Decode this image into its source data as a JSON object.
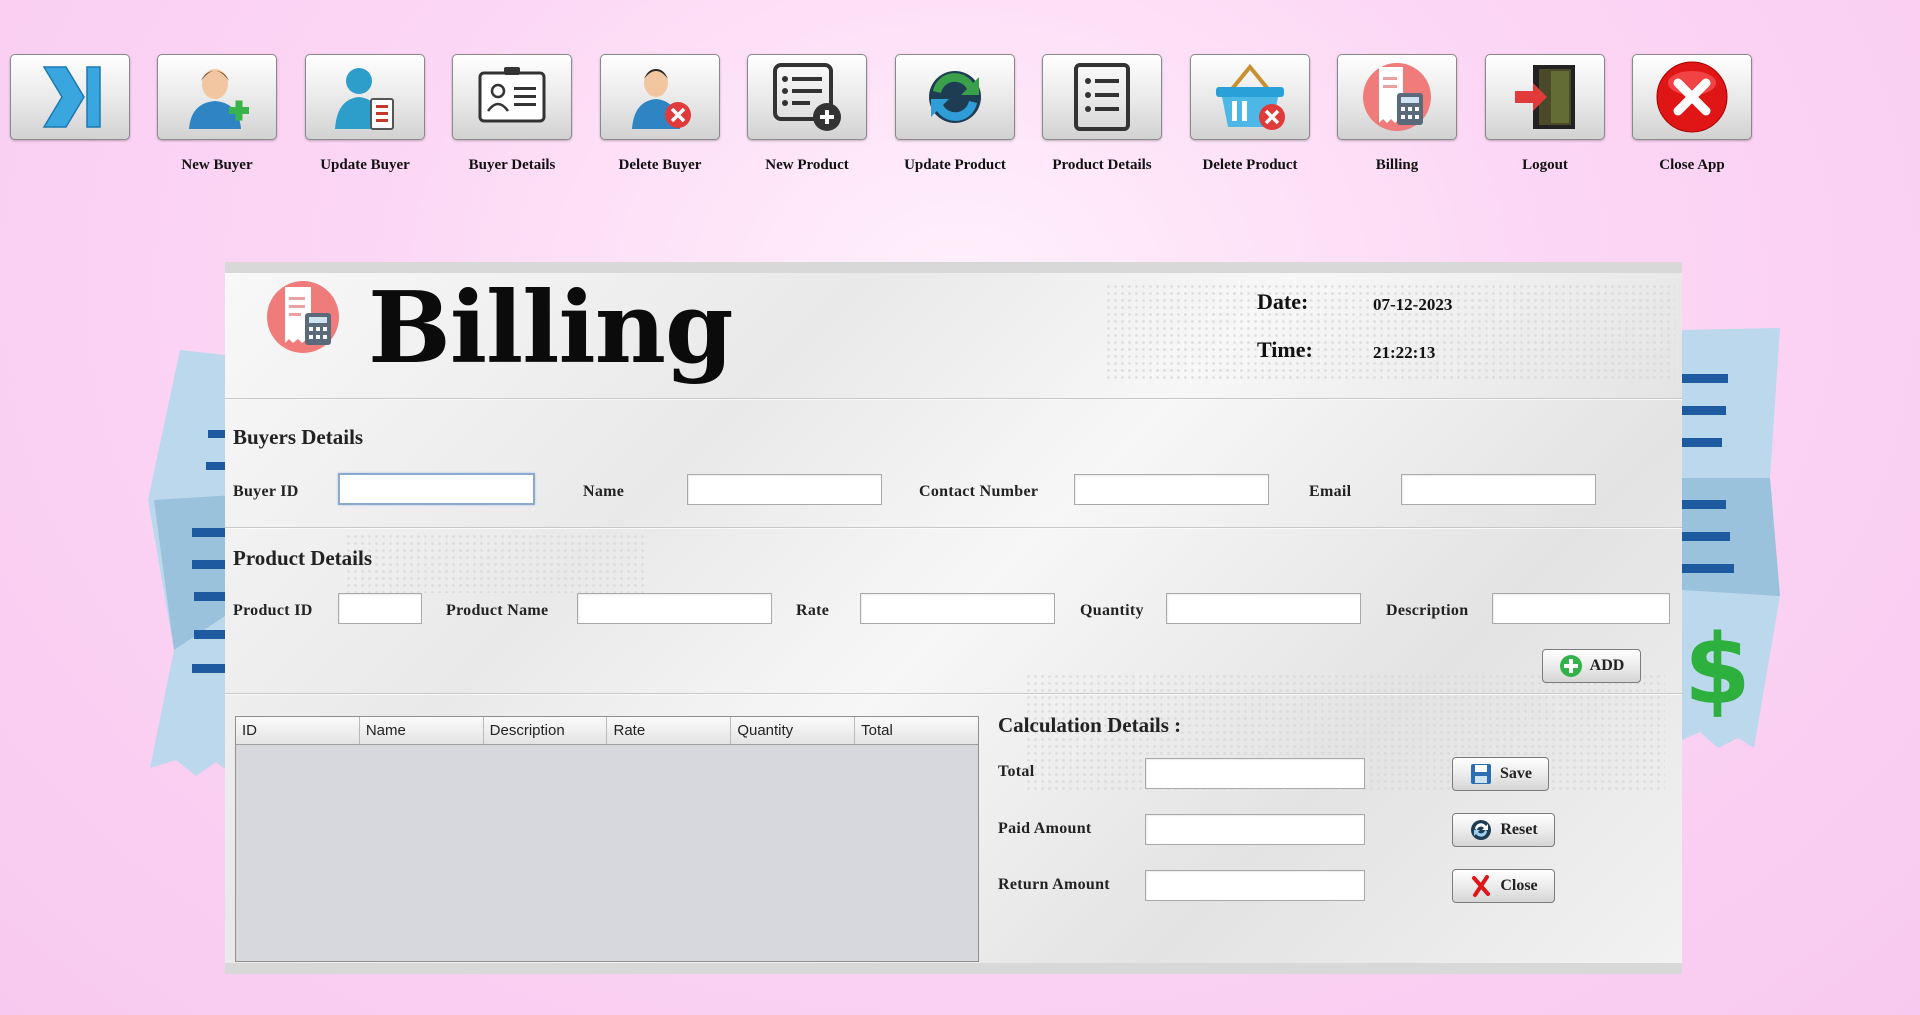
{
  "toolbar": {
    "items": [
      {
        "label": "",
        "icon": "skip-forward-icon"
      },
      {
        "label": "New Buyer",
        "icon": "add-user-icon"
      },
      {
        "label": "Update Buyer",
        "icon": "update-user-icon"
      },
      {
        "label": "Buyer Details",
        "icon": "id-card-icon"
      },
      {
        "label": "Delete Buyer",
        "icon": "delete-user-icon"
      },
      {
        "label": "New Product",
        "icon": "add-list-icon"
      },
      {
        "label": "Update Product",
        "icon": "refresh-icon"
      },
      {
        "label": "Product Details",
        "icon": "list-icon"
      },
      {
        "label": "Delete Product",
        "icon": "delete-basket-icon"
      },
      {
        "label": "Billing",
        "icon": "billing-icon"
      },
      {
        "label": "Logout",
        "icon": "logout-door-icon"
      },
      {
        "label": "Close App",
        "icon": "close-circle-icon"
      }
    ]
  },
  "header": {
    "title": "Billing",
    "date_label": "Date:",
    "date_value": "07-12-2023",
    "time_label": "Time:",
    "time_value": "21:22:13"
  },
  "buyers": {
    "title": "Buyers Details",
    "buyer_id_label": "Buyer ID",
    "buyer_id_value": "",
    "name_label": "Name",
    "name_value": "",
    "contact_label": "Contact Number",
    "contact_value": "",
    "email_label": "Email",
    "email_value": ""
  },
  "product": {
    "title": "Product Details",
    "product_id_label": "Product ID",
    "product_id_value": "",
    "product_name_label": "Product Name",
    "product_name_value": "",
    "rate_label": "Rate",
    "rate_value": "",
    "quantity_label": "Quantity",
    "quantity_value": "",
    "description_label": "Description",
    "description_value": "",
    "add_label": "ADD"
  },
  "table": {
    "columns": [
      "ID",
      "Name",
      "Description",
      "Rate",
      "Quantity",
      "Total"
    ],
    "rows": []
  },
  "calculation": {
    "title": "Calculation Details :",
    "total_label": "Total",
    "total_value": "",
    "paid_label": "Paid Amount",
    "paid_value": "",
    "return_label": "Return Amount",
    "return_value": "",
    "save_label": "Save",
    "reset_label": "Reset",
    "close_label": "Close"
  },
  "colors": {
    "background": "#fcd6f5",
    "receipt_blue": "#b8d6ea",
    "line_blue": "#1e5aa0",
    "dollar_green": "#2eb03e",
    "close_red": "#e01515"
  }
}
